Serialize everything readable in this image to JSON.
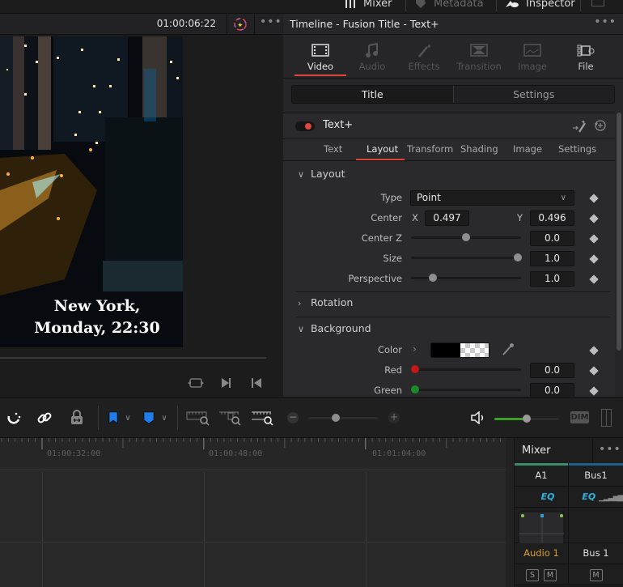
{
  "top_bar": {
    "buttons": [
      {
        "label": "Mixer",
        "icon": "mixer-sliders-icon",
        "active": true
      },
      {
        "label": "Metadata",
        "icon": "metadata-tag-icon",
        "active": false
      },
      {
        "label": "Inspector",
        "icon": "inspector-icon",
        "active": true
      }
    ]
  },
  "viewer": {
    "timecode": "01:00:06:22",
    "caption_line1": "New York,",
    "caption_line2": "Monday, 22:30",
    "controls": [
      "loop-icon",
      "next-frame-icon",
      "prev-frame-icon"
    ]
  },
  "inspector": {
    "title": "Timeline - Fusion Title - Text+",
    "panel_tabs": [
      {
        "label": "Video",
        "icon": "film-icon",
        "state": "active"
      },
      {
        "label": "Audio",
        "icon": "music-note-icon",
        "state": "disabled"
      },
      {
        "label": "Effects",
        "icon": "magic-wand-icon",
        "state": "disabled"
      },
      {
        "label": "Transition",
        "icon": "transition-icon",
        "state": "disabled"
      },
      {
        "label": "Image",
        "icon": "image-icon",
        "state": "disabled"
      },
      {
        "label": "File",
        "icon": "camera-icon",
        "state": "enabled"
      }
    ],
    "segment": {
      "title": "Title",
      "settings": "Settings",
      "selected": "Title"
    },
    "node": {
      "name": "Text+",
      "enabled": true,
      "sub_tabs": [
        "Text",
        "Layout",
        "Transform",
        "Shading",
        "Image",
        "Settings"
      ],
      "active_sub_tab": "Layout"
    },
    "layout": {
      "section": "Layout",
      "type_label": "Type",
      "type_value": "Point",
      "center_label": "Center",
      "center_x_label": "X",
      "center_x": "0.497",
      "center_y_label": "Y",
      "center_y": "0.496",
      "center_z_label": "Center Z",
      "center_z": "0.0",
      "center_z_slider": 0.5,
      "size_label": "Size",
      "size": "1.0",
      "size_slider": 0.97,
      "perspective_label": "Perspective",
      "perspective": "1.0",
      "perspective_slider": 0.2
    },
    "rotation": {
      "section": "Rotation"
    },
    "background": {
      "section": "Background",
      "color_label": "Color",
      "color_value": "#000000",
      "red_label": "Red",
      "red": "0.0",
      "green_label": "Green",
      "green": "0.0"
    }
  },
  "toolbar": {
    "zoom_slider": 0.4,
    "volume_slider": 0.5,
    "dim_label": "DIM"
  },
  "timeline": {
    "ruler_labels": [
      "01:00:32:00",
      "01:00:48:00",
      "01:01:04:00"
    ]
  },
  "mixer": {
    "title": "Mixer",
    "channels": [
      {
        "id": "A1",
        "name": "Audio 1",
        "eq": "EQ",
        "buttons": [
          "S",
          "M"
        ],
        "color": "#3c8c6a"
      },
      {
        "id": "Bus1",
        "name": "Bus 1",
        "eq": "EQ",
        "buttons": [
          "M"
        ],
        "color": "#1f5f8a"
      }
    ]
  },
  "colors": {
    "accent_red": "#e0453a",
    "eq_cyan": "#2ab4dd",
    "audio_orange": "#d9a030",
    "volume_green": "#3aa02a"
  }
}
